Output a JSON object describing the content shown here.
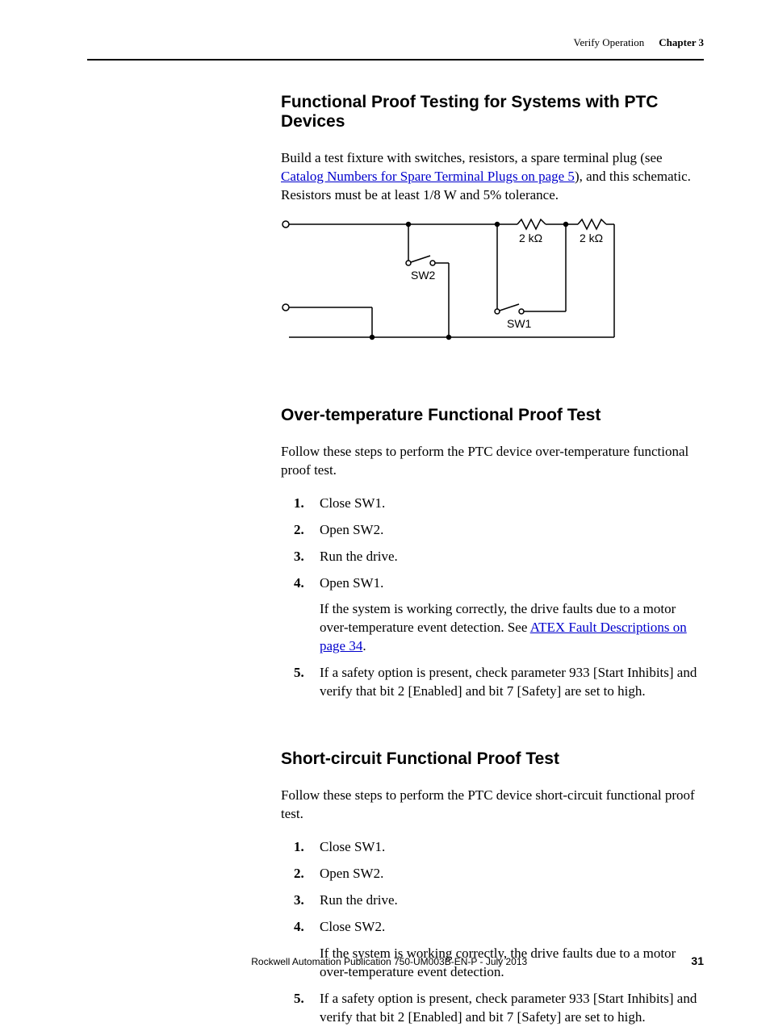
{
  "header": {
    "section": "Verify Operation",
    "chapter": "Chapter 3"
  },
  "section1": {
    "title": "Functional Proof Testing for Systems with PTC Devices",
    "para_pre": "Build a test fixture with switches, resistors, a spare terminal plug (see ",
    "link": "Catalog Numbers for Spare Terminal Plugs on page 5",
    "para_post": "), and this schematic. Resistors must be at least 1/8 W and 5% tolerance."
  },
  "schematic": {
    "sw1": "SW1",
    "sw2": "SW2",
    "r1": "2 kΩ",
    "r2": "2 kΩ"
  },
  "section2": {
    "title": "Over-temperature Functional Proof Test",
    "intro": "Follow these steps to perform the PTC device over-temperature functional proof test.",
    "steps": [
      "Close SW1.",
      "Open SW2.",
      "Run the drive.",
      "Open SW1.",
      "If a safety option is present, check parameter 933 [Start Inhibits] and verify that bit 2 [Enabled] and bit 7 [Safety] are set to high."
    ],
    "step4_sub_pre": "If the system is working correctly, the drive faults due to a motor over-temperature event detection. See ",
    "step4_link": "ATEX Fault Descriptions on page 34",
    "step4_sub_post": "."
  },
  "section3": {
    "title": "Short-circuit Functional Proof Test",
    "intro": "Follow these steps to perform the PTC device short-circuit functional proof test.",
    "steps": [
      "Close SW1.",
      "Open SW2.",
      "Run the drive.",
      "Close SW2.",
      "If a safety option is present, check parameter 933 [Start Inhibits] and verify that bit 2 [Enabled] and bit 7 [Safety] are set to high."
    ],
    "step4_sub": "If the system is working correctly, the drive faults due to a motor over-temperature event detection."
  },
  "footer": {
    "publication": "Rockwell Automation Publication 750-UM003B-EN-P - July 2013",
    "page": "31"
  }
}
